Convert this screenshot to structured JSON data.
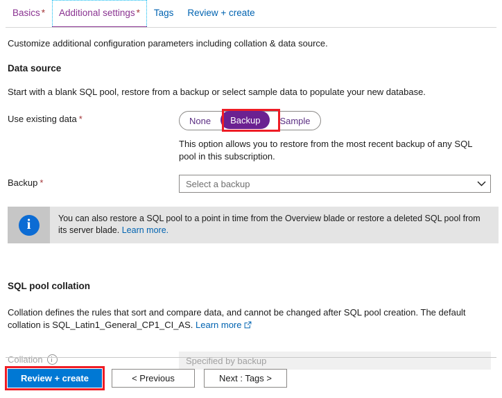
{
  "tabs": [
    {
      "label": "Basics",
      "required": true,
      "state": "visited"
    },
    {
      "label": "Additional settings",
      "required": true,
      "state": "selected"
    },
    {
      "label": "Tags",
      "required": false,
      "state": "default"
    },
    {
      "label": "Review + create",
      "required": false,
      "state": "default"
    }
  ],
  "required_marker": "*",
  "intro": "Customize additional configuration parameters including collation & data source.",
  "data_source": {
    "heading": "Data source",
    "description": "Start with a blank SQL pool, restore from a backup or select sample data to populate your new database.",
    "use_existing_data": {
      "label": "Use existing data",
      "options": [
        "None",
        "Backup",
        "Sample"
      ],
      "selected": "Backup",
      "option_description": "This option allows you to restore from the most recent backup of any SQL pool in this subscription."
    },
    "backup": {
      "label": "Backup",
      "placeholder": "Select a backup",
      "value": ""
    },
    "info_banner": {
      "icon": "info-icon",
      "text": "You can also restore a SQL pool to a point in time from the Overview blade or restore a deleted SQL pool from its server blade.",
      "link_label": "Learn more."
    }
  },
  "collation_section": {
    "heading": "SQL pool collation",
    "description": "Collation defines the rules that sort and compare data, and cannot be changed after SQL pool creation. The default collation is SQL_Latin1_General_CP1_CI_AS.",
    "link_label": "Learn more",
    "collation_field": {
      "label": "Collation",
      "placeholder": "Specified by backup",
      "value": "",
      "disabled": true
    }
  },
  "footer": {
    "review_create_label": "Review + create",
    "previous_label": "< Previous",
    "next_label": "Next : Tags >"
  },
  "colors": {
    "accent_blue": "#0078d4",
    "link_blue": "#0063b1",
    "selected_tab_purple": "#8a3391",
    "pill_selected_purple": "#6b2191",
    "required_red": "#a4373a",
    "annotation_red": "#ee1c25",
    "info_icon_blue": "#0c6cd4",
    "banner_bg": "#e4e4e4",
    "banner_icon_bg": "#c6c6c6",
    "disabled_field_bg": "#f0f0f0"
  },
  "annotations": [
    {
      "name": "backup-pill-highlight",
      "target": "Backup"
    },
    {
      "name": "review-create-button-highlight",
      "target": "Review + create"
    }
  ]
}
